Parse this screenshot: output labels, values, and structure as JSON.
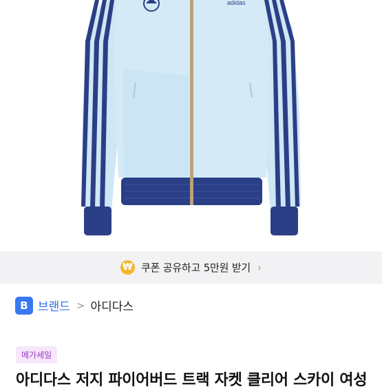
{
  "product": {
    "image_alt": "adidas",
    "logo_text": "adidas",
    "colors": {
      "jacket_body": "#cfe6f5",
      "stripes": "#2b3f86",
      "zipper": "#b9a27a"
    }
  },
  "coupon": {
    "icon_symbol": "₩",
    "text": "쿠폰 공유하고 5만원 받기",
    "chevron": "›"
  },
  "breadcrumb": {
    "badge": "B",
    "brand_label": "브랜드",
    "separator": ">",
    "brand_name": "아디다스"
  },
  "sale_tag": "메가세일",
  "title": "아디다스 저지 파이어버드 트랙 자켓 클리어 스카이 여성"
}
